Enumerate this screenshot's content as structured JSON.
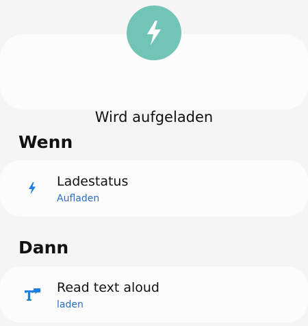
{
  "header": {
    "title": "Wird aufgeladen",
    "icon": "lightning-bolt-icon",
    "icon_color": "#71c4b6"
  },
  "if_section": {
    "title": "Wenn",
    "condition": {
      "icon": "lightning-bolt-icon",
      "title": "Ladestatus",
      "value": "Aufladen"
    }
  },
  "then_section": {
    "title": "Dann",
    "action": {
      "icon": "text-to-speech-icon",
      "title": "Read text aloud",
      "value": "laden"
    }
  },
  "colors": {
    "accent": "#2b6ec0",
    "icon_blue": "#1a7fe0",
    "card_background": "#fcfcfc",
    "page_background": "#f5f5f5"
  }
}
